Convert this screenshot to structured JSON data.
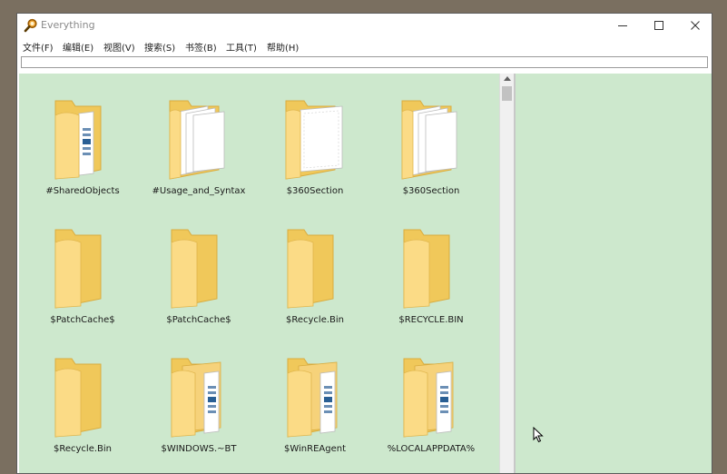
{
  "window": {
    "title": "Everything",
    "title_icon": "magnifier-icon"
  },
  "menu": [
    {
      "label": "文件(F)"
    },
    {
      "label": "编辑(E)"
    },
    {
      "label": "视图(V)"
    },
    {
      "label": "搜索(S)"
    },
    {
      "label": "书签(B)"
    },
    {
      "label": "工具(T)"
    },
    {
      "label": "帮助(H)"
    }
  ],
  "search": {
    "value": "",
    "placeholder": ""
  },
  "items": [
    {
      "name": "#SharedObjects",
      "icon": "folder-with-document-icon"
    },
    {
      "name": "#Usage_and_Syntax",
      "icon": "folder-with-papers-icon"
    },
    {
      "name": "$360Section",
      "icon": "folder-with-paper-icon"
    },
    {
      "name": "$360Section",
      "icon": "folder-with-papers-icon"
    },
    {
      "name": "$PatchCache$",
      "icon": "folder-icon"
    },
    {
      "name": "$PatchCache$",
      "icon": "folder-icon"
    },
    {
      "name": "$Recycle.Bin",
      "icon": "folder-icon"
    },
    {
      "name": "$RECYCLE.BIN",
      "icon": "folder-icon"
    },
    {
      "name": "$Recycle.Bin",
      "icon": "folder-icon"
    },
    {
      "name": "$WINDOWS.~BT",
      "icon": "folder-with-document-icon"
    },
    {
      "name": "$WinREAgent",
      "icon": "folder-with-document-icon"
    },
    {
      "name": "%LOCALAPPDATA%",
      "icon": "folder-with-document-icon"
    }
  ],
  "colors": {
    "content_background": "#cde8cd",
    "folder_back": "#f0c85a",
    "folder_front": "#fbdb86"
  }
}
